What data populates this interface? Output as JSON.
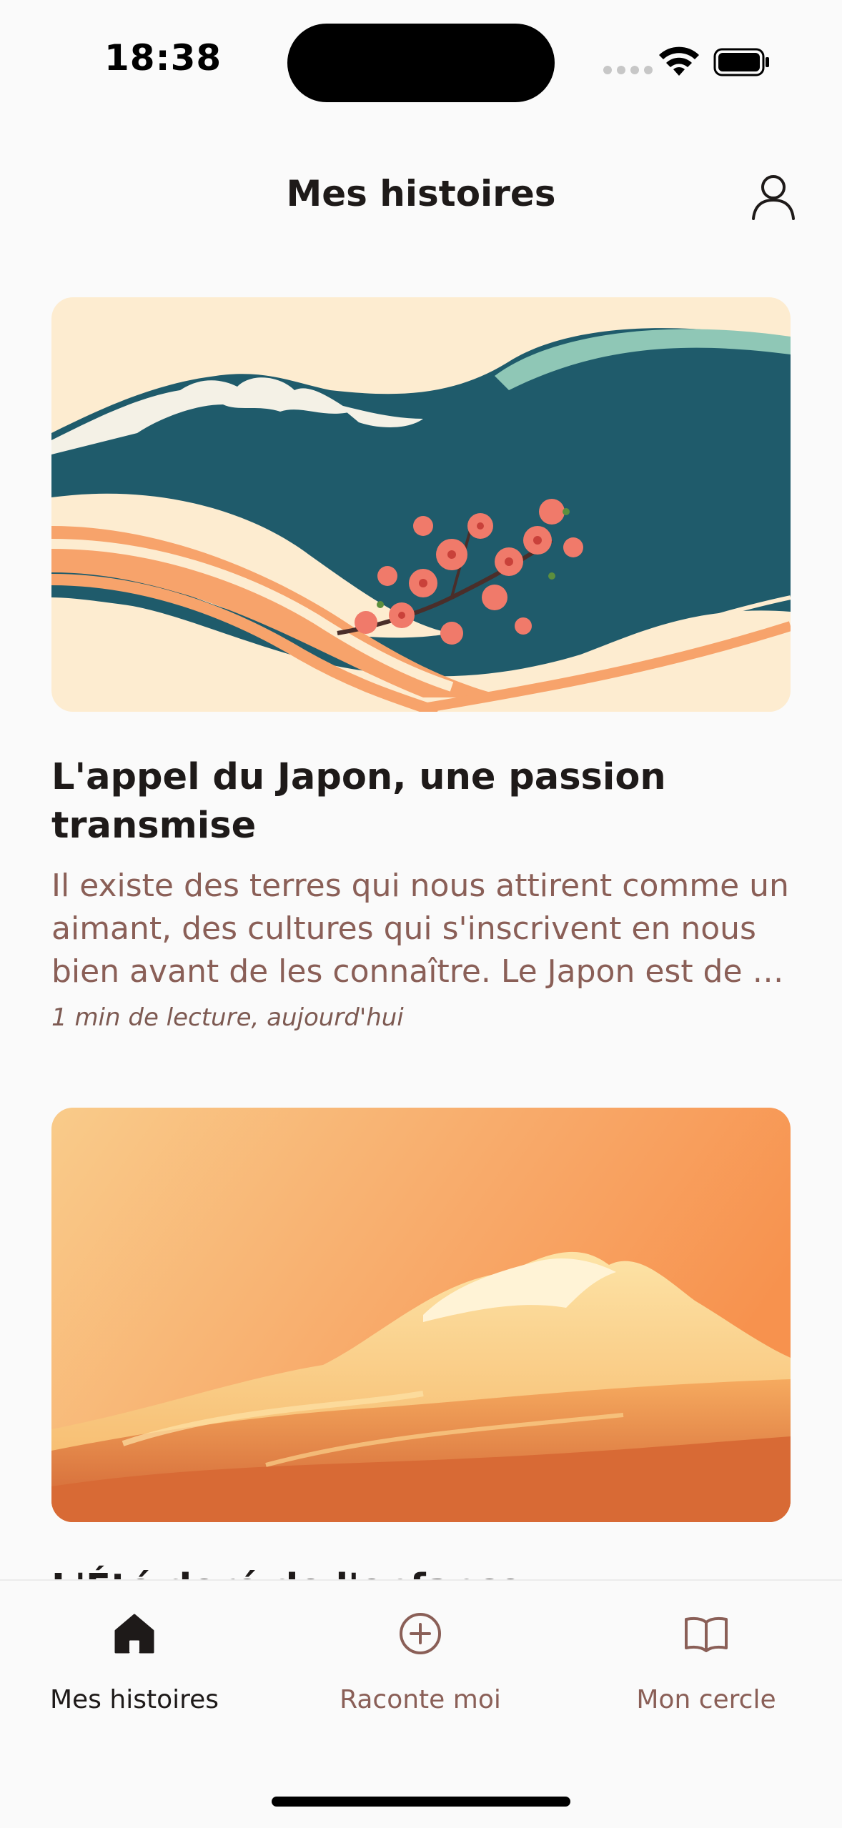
{
  "status_bar": {
    "time": "18:38"
  },
  "header": {
    "title": "Mes histoires",
    "profile_icon": "user-icon"
  },
  "stories": [
    {
      "title": "L'appel du Japon, une passion transmise",
      "excerpt": "Il existe des terres qui nous attirent comme un aimant, des cultures qui s'inscrivent en nous bien avant de les connaître. Le Japon est de …",
      "meta": "1 min de lecture, aujourd'hui",
      "image": "japanese-wave-with-cherry-blossoms"
    },
    {
      "title": "L'Été doré de l'enfance",
      "image": "golden-ocean-wave"
    }
  ],
  "nav": {
    "items": [
      {
        "label": "Mes histoires",
        "icon": "home-icon",
        "active": true
      },
      {
        "label": "Raconte moi",
        "icon": "plus-circle-icon",
        "active": false
      },
      {
        "label": "Mon cercle",
        "icon": "book-icon",
        "active": false
      }
    ]
  },
  "colors": {
    "background": "#fafafa",
    "text": "#1e1a19",
    "accent": "#8a5f57",
    "wave_teal": "#1f5b6b",
    "wave_orange": "#f7a36b"
  }
}
